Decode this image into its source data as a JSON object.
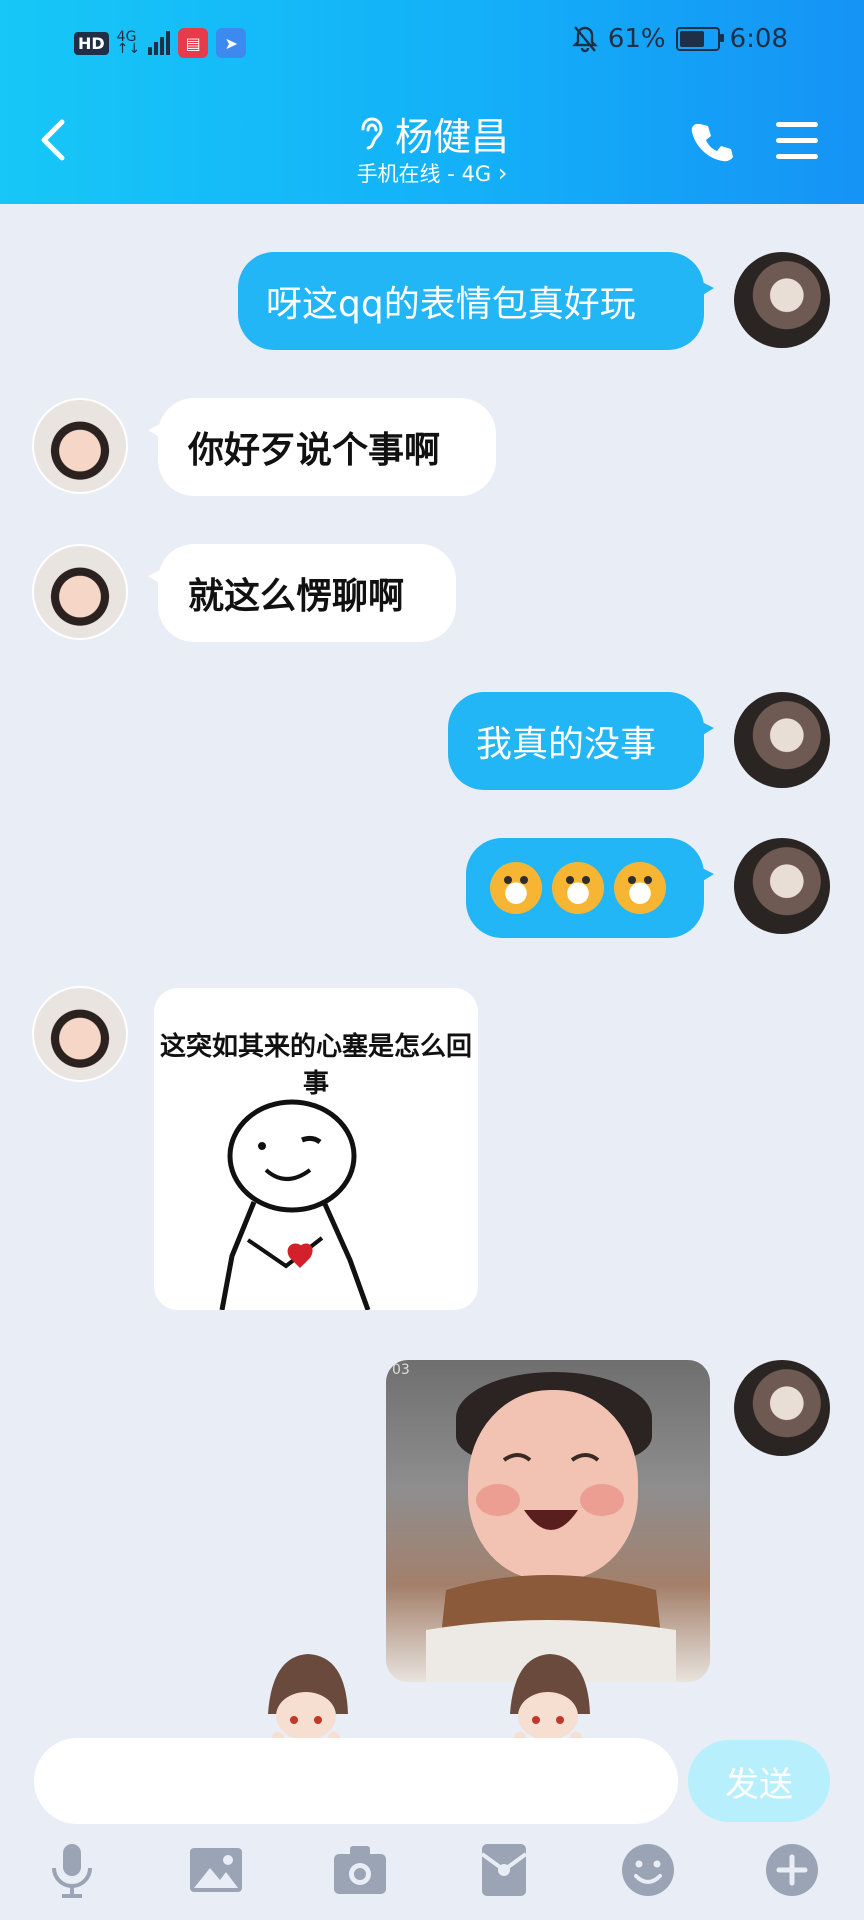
{
  "status_bar": {
    "hd_label": "HD",
    "network_label": "4G",
    "network_sub": "↑↓",
    "battery": "61%",
    "time": "6:08"
  },
  "header": {
    "contact_name": "杨健昌",
    "status": "手机在线 - 4G",
    "icons": [
      "back-chevron-icon",
      "ear-icon",
      "phone-icon",
      "menu-icon"
    ]
  },
  "messages": [
    {
      "side": "out",
      "text": "呀这qq的表情包真好玩"
    },
    {
      "side": "in",
      "text": "你好歹说个事啊"
    },
    {
      "side": "in",
      "text": "就这么愣聊啊"
    },
    {
      "side": "out",
      "text": "我真的没事"
    },
    {
      "side": "out",
      "type": "emoji",
      "emoji": [
        "cat-face-emoji",
        "cat-face-emoji",
        "cat-face-emoji"
      ]
    },
    {
      "side": "in",
      "type": "sticker",
      "caption": "这突如其来的心塞是怎么回事"
    },
    {
      "side": "out",
      "type": "photo",
      "tag": "03"
    }
  ],
  "composer": {
    "input_value": "",
    "send_label": "发送",
    "tools": [
      "microphone-icon",
      "image-icon",
      "camera-icon",
      "red-packet-icon",
      "emoji-icon",
      "plus-icon"
    ]
  },
  "colors": {
    "header_start": "#16C7F7",
    "header_end": "#1593F6",
    "outgoing_bubble": "#22B6F7",
    "chat_background": "#E9EDF5",
    "send_disabled": "#B8EFFD",
    "tool_icon": "#9AA4B5"
  }
}
